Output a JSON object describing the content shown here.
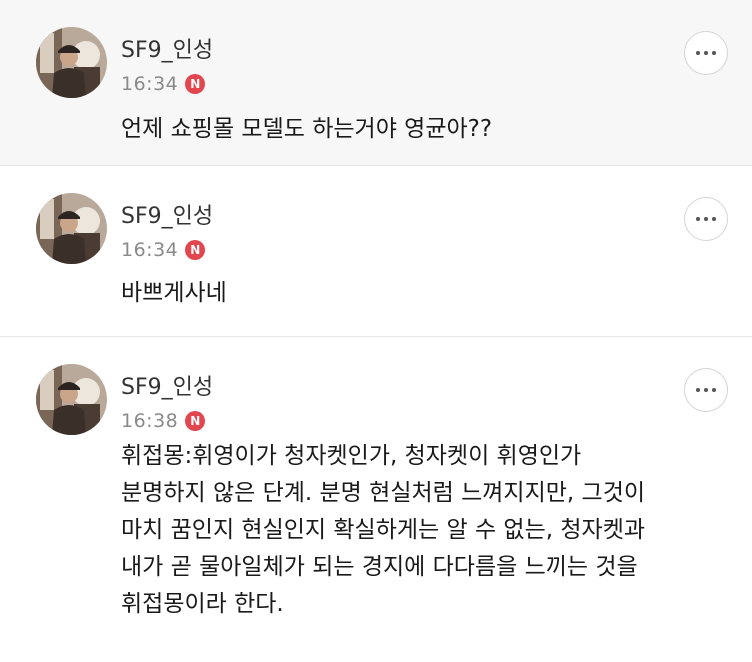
{
  "posts": [
    {
      "username": "SF9_인성",
      "time": "16:34",
      "badge": "N",
      "lines": [
        "언제 쇼핑몰 모델도 하는거야 영균아??"
      ]
    },
    {
      "username": "SF9_인성",
      "time": "16:34",
      "badge": "N",
      "lines": [
        "바쁘게사네"
      ]
    },
    {
      "username": "SF9_인성",
      "time": "16:38",
      "badge": "N",
      "lines": [
        "휘접몽:휘영이가 청자켓인가, 청자켓이 휘영인가",
        "분명하지 않은 단계. 분명 현실처럼 느껴지지만, 그것이",
        "마치 꿈인지 현실인지 확실하게는 알 수 없는, 청자켓과",
        "내가 곧 물아일체가 되는 경지에 다다름을 느끼는 것을",
        "휘접몽이라 한다."
      ]
    }
  ]
}
